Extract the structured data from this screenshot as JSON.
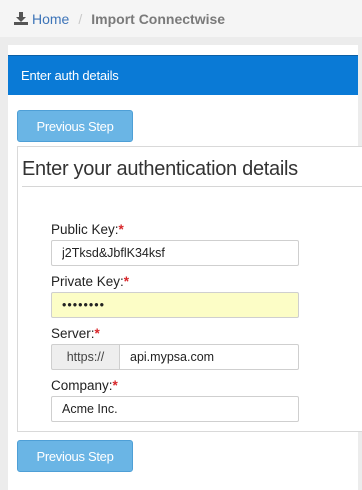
{
  "breadcrumb": {
    "home_icon": "download-icon",
    "home_label": "Home",
    "separator": "/",
    "current": "Import Connectwise"
  },
  "panel": {
    "header_title": "Enter auth details"
  },
  "buttons": {
    "previous_step_top": "Previous Step",
    "previous_step_bottom": "Previous Step"
  },
  "form": {
    "title": "Enter your authentication details",
    "required_marker": "*",
    "public_key": {
      "label": "Public Key:",
      "value": "j2Tksd&JbflK34ksf"
    },
    "private_key": {
      "label": "Private Key:",
      "value": "••••••••"
    },
    "server": {
      "label": "Server:",
      "prefix": "https://",
      "value": "api.mypsa.com"
    },
    "company": {
      "label": "Company:",
      "value": "Acme Inc."
    }
  },
  "colors": {
    "header_bg": "#0a7ad6",
    "button_bg": "#6ab5e5",
    "autofill_bg": "#fcfdc6",
    "required": "#d8262a",
    "link": "#3d74b8"
  }
}
